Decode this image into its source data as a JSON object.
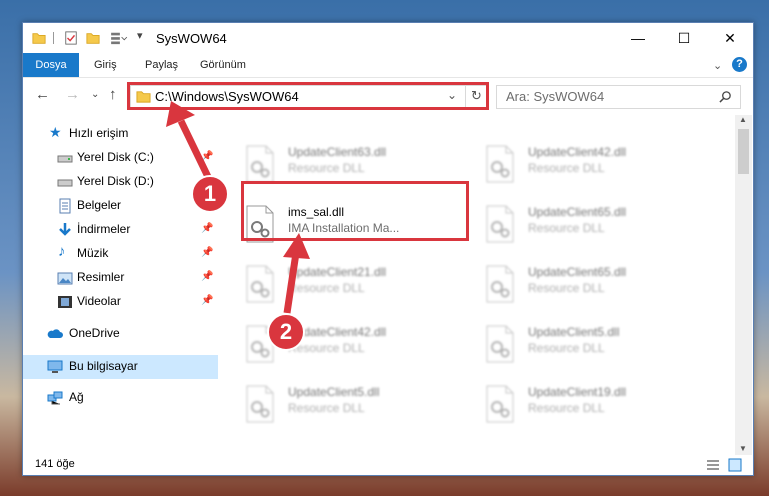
{
  "window": {
    "title": "SysWOW64"
  },
  "ribbon": {
    "tabs": [
      "Dosya",
      "Giriş",
      "Paylaş",
      "Görünüm"
    ]
  },
  "address": {
    "path": "C:\\Windows\\SysWOW64"
  },
  "search": {
    "placeholder": "Ara: SysWOW64"
  },
  "nav": {
    "quick_access": "Hızlı erişim",
    "items": [
      {
        "label": "Yerel Disk (C:)",
        "icon": "drive-icon"
      },
      {
        "label": "Yerel Disk (D:)",
        "icon": "drive-icon"
      },
      {
        "label": "Belgeler",
        "icon": "documents-icon"
      },
      {
        "label": "İndirmeler",
        "icon": "download-icon"
      },
      {
        "label": "Müzik",
        "icon": "music-icon"
      },
      {
        "label": "Resimler",
        "icon": "pictures-icon"
      },
      {
        "label": "Videolar",
        "icon": "videos-icon"
      }
    ],
    "onedrive": "OneDrive",
    "this_pc": "Bu bilgisayar",
    "network": "Ağ"
  },
  "files": [
    {
      "name": "UpdateClient63.dll",
      "desc": "Resource DLL"
    },
    {
      "name": "UpdateClient42.dll",
      "desc": "Resource DLL"
    },
    {
      "name": "ims_sal.dll",
      "desc": "IMA Installation Ma..."
    },
    {
      "name": "UpdateClient65.dll",
      "desc": "Resource DLL"
    },
    {
      "name": "UpdateClient21.dll",
      "desc": "Resource DLL"
    },
    {
      "name": "UpdateClient65.dll",
      "desc": "Resource DLL"
    },
    {
      "name": "UpdateClient42.dll",
      "desc": "Resource DLL"
    },
    {
      "name": "UpdateClient5.dll",
      "desc": "Resource DLL"
    },
    {
      "name": "UpdateClient5.dll",
      "desc": "Resource DLL"
    },
    {
      "name": "UpdateClient19.dll",
      "desc": "Resource DLL"
    }
  ],
  "status": {
    "count": "141 öğe"
  },
  "annotations": {
    "step1": "1",
    "step2": "2"
  },
  "colors": {
    "accent": "#1979ca",
    "highlight": "#d9363e",
    "selection": "#cce8ff"
  }
}
